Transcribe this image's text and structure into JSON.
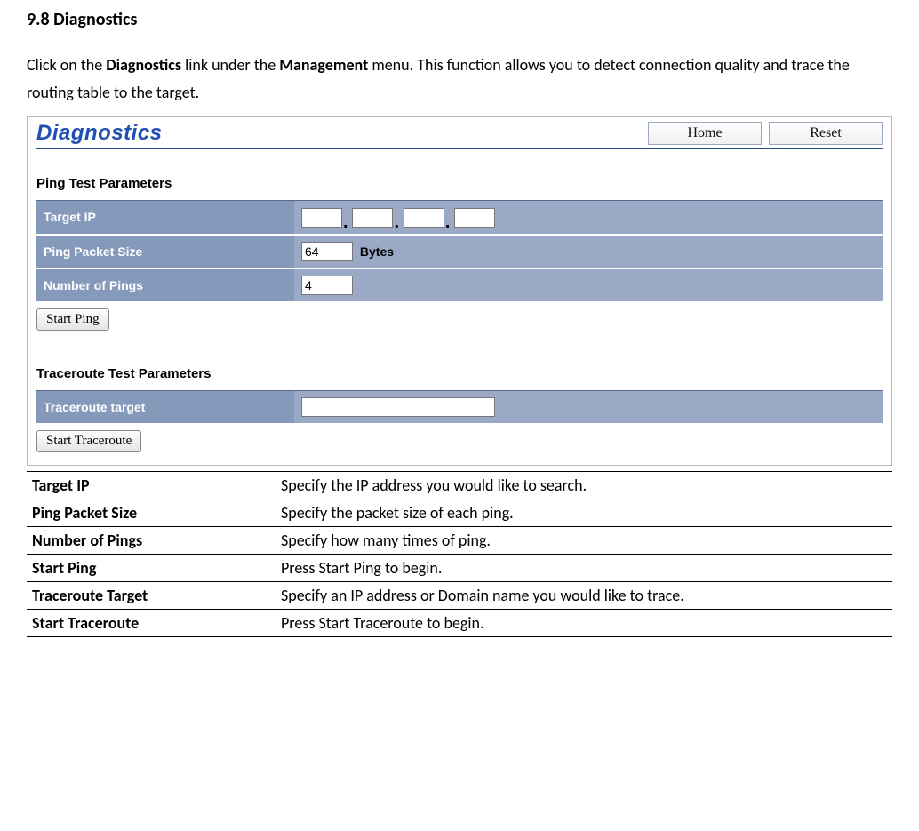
{
  "heading": "9.8 Diagnostics",
  "intro": {
    "pre1": "Click on the ",
    "bold1": "Diagnostics",
    "mid1": " link under the ",
    "bold2": "Management",
    "post1": " menu. This function allows you to detect connection quality and trace the routing table to the target."
  },
  "panel": {
    "title": "Diagnostics",
    "nav": {
      "home": "Home",
      "reset": "Reset"
    },
    "ping": {
      "heading": "Ping Test Parameters",
      "rows": {
        "target_ip_label": "Target IP",
        "packet_size_label": "Ping Packet Size",
        "packet_size_value": "64",
        "bytes_label": "Bytes",
        "num_pings_label": "Number of Pings",
        "num_pings_value": "4"
      },
      "button": "Start Ping"
    },
    "trace": {
      "heading": "Traceroute Test Parameters",
      "rows": {
        "target_label": "Traceroute target"
      },
      "button": "Start Traceroute"
    }
  },
  "desc": [
    {
      "term": "Target IP",
      "text": "Specify the IP address you would like to search."
    },
    {
      "term": "Ping Packet Size",
      "text": "Specify the packet size of each ping."
    },
    {
      "term": "Number of Pings",
      "text": "Specify how many times of ping."
    },
    {
      "term": "Start Ping",
      "text": "Press Start Ping to begin."
    },
    {
      "term": "Traceroute Target",
      "text": "Specify an IP address or Domain name you would like to trace."
    },
    {
      "term": "Start Traceroute",
      "text": "Press Start Traceroute to begin."
    }
  ]
}
